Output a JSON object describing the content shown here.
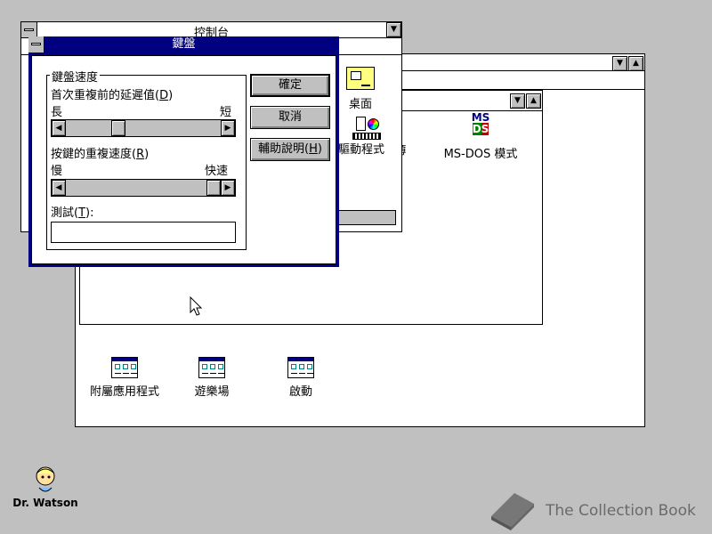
{
  "control_panel": {
    "title": "控制台",
    "icons": [
      {
        "label": "桌面",
        "icon": "desktop-icon"
      },
      {
        "label": "驅動程式",
        "icon": "drivers-icon"
      }
    ]
  },
  "program_manager": {
    "groups": [
      {
        "label": "附屬應用程式",
        "icon": "group-icon"
      },
      {
        "label": "遊樂場",
        "icon": "group-icon"
      },
      {
        "label": "啟動",
        "icon": "group-icon"
      }
    ]
  },
  "main_group": {
    "icons": [
      {
        "label": "MS-DOS 模式",
        "icon": "msdos-icon"
      },
      {
        "label": "簿",
        "icon": "partial-icon"
      }
    ]
  },
  "keyboard_dialog": {
    "title": "鍵盤",
    "group_label": "鍵盤速度",
    "delay_label": "首次重複前的延遲值(",
    "delay_key": "D",
    "delay_label_end": ")",
    "delay_min": "長",
    "delay_max": "短",
    "delay_value": 0.32,
    "rate_label": "按鍵的重複速度(",
    "rate_key": "R",
    "rate_label_end": ")",
    "rate_min": "慢",
    "rate_max": "快速",
    "rate_value": 1.0,
    "test_label": "測試(",
    "test_key": "T",
    "test_label_end": "):",
    "test_value": "",
    "ok_label": "確定",
    "cancel_label": "取消",
    "help_label": "輔助說明(",
    "help_key": "H",
    "help_label_end": ")"
  },
  "desktop": {
    "drwatson_label": "Dr. Watson",
    "watermark": "The Collection Book"
  }
}
